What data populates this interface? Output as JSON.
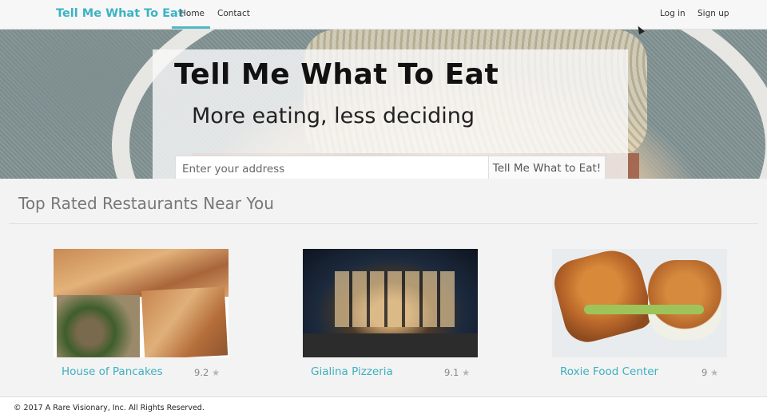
{
  "navbar": {
    "brand": "Tell Me What To Eat",
    "links": [
      {
        "label": "Home",
        "active": true
      },
      {
        "label": "Contact",
        "active": false
      }
    ],
    "right_links": [
      {
        "label": "Log in"
      },
      {
        "label": "Sign up"
      }
    ]
  },
  "hero": {
    "title": "Tell Me What To Eat",
    "subtitle": "More eating, less deciding",
    "address_placeholder": "Enter your address",
    "submit_label": "Tell Me What to Eat!"
  },
  "section": {
    "title": "Top Rated Restaurants Near You"
  },
  "restaurants": [
    {
      "name": "House of Pancakes",
      "rating": "9.2",
      "star": "★"
    },
    {
      "name": "Gialina Pizzeria",
      "rating": "9.1",
      "star": "★"
    },
    {
      "name": "Roxie Food Center",
      "rating": "9",
      "star": "★"
    }
  ],
  "footer": {
    "text": "© 2017 A Rare Visionary, Inc. All Rights Reserved."
  },
  "colors": {
    "accent": "#3bb3c3",
    "text": "#333333",
    "muted": "#777777"
  },
  "icons": {
    "rating": "star-icon",
    "cursor": "mouse-cursor-icon"
  }
}
